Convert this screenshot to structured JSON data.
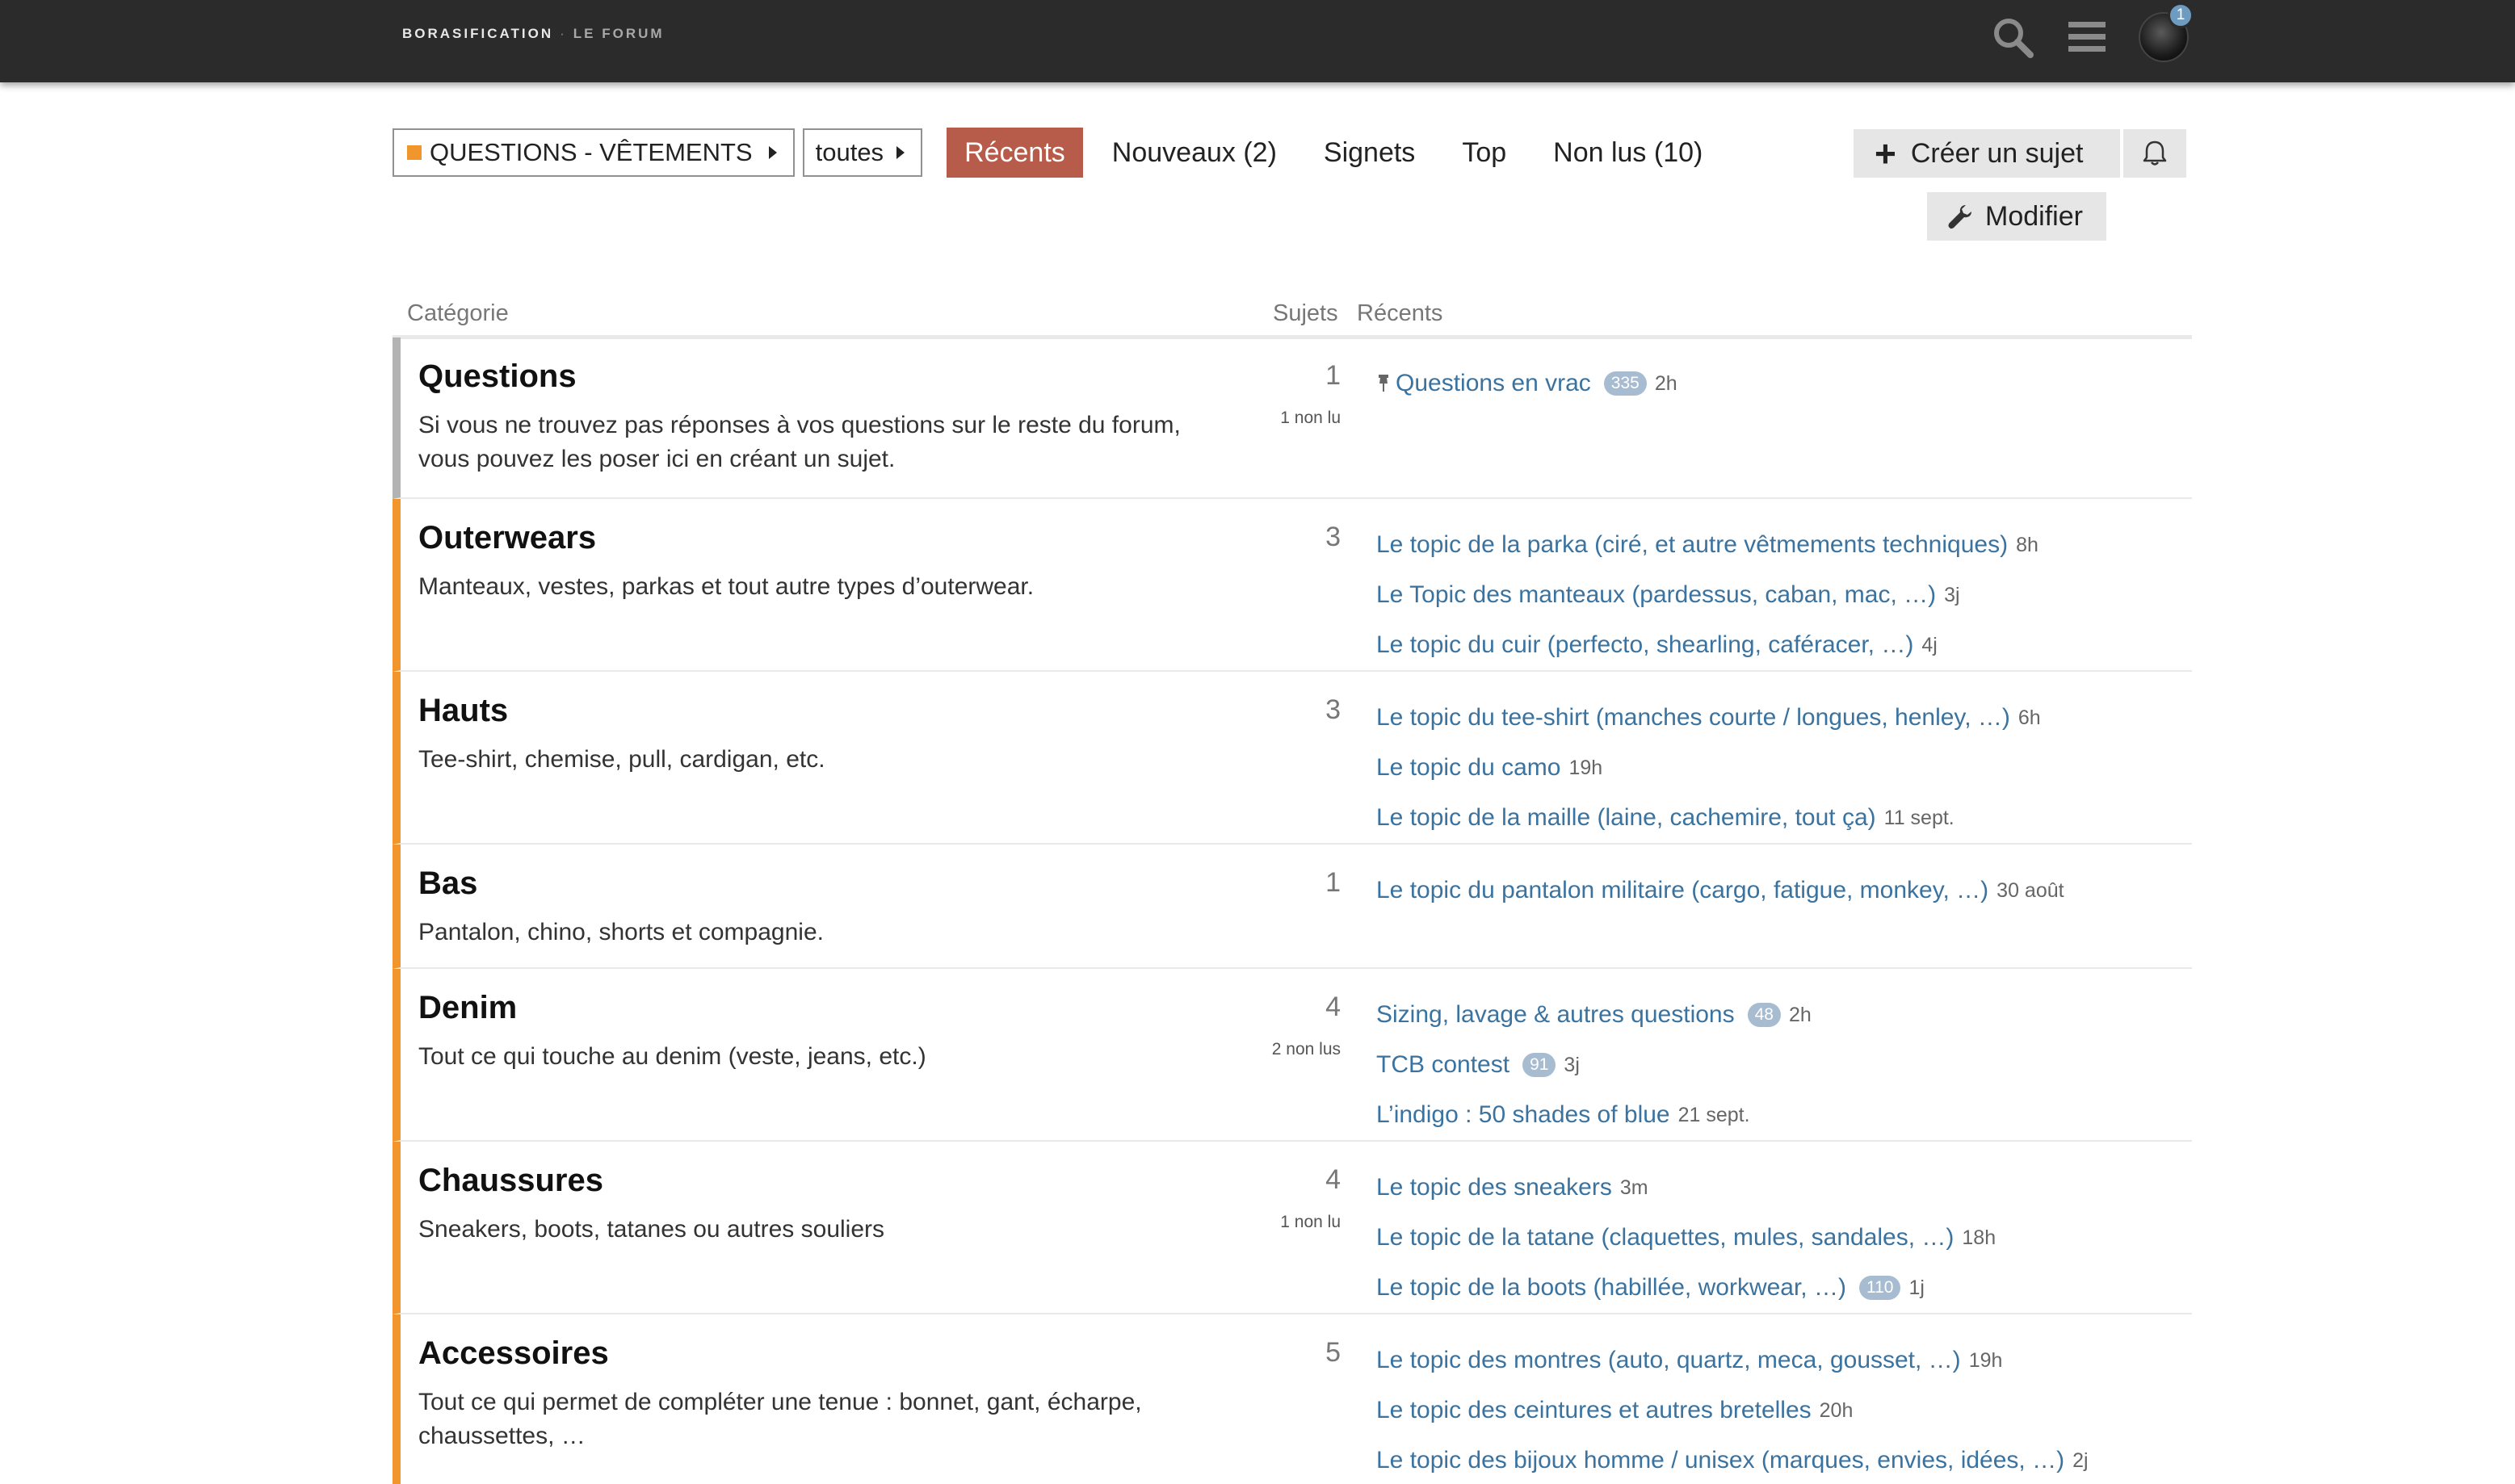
{
  "header": {
    "logo": "BORASIFICATION",
    "logo_sep": "·",
    "logo_sub": "LE FORUM",
    "icons": [
      "search-icon",
      "menu-icon",
      "avatar"
    ],
    "notification_count": "1"
  },
  "nav": {
    "category_dropdown": "QUESTIONS - VÊTEMENTS",
    "sub_dropdown": "toutes",
    "tabs": [
      {
        "label": "Récents",
        "active": true
      },
      {
        "label": "Nouveaux (2)",
        "active": false
      },
      {
        "label": "Signets",
        "active": false
      },
      {
        "label": "Top",
        "active": false
      },
      {
        "label": "Non lus (10)",
        "active": false
      }
    ],
    "create_button": "Créer un sujet",
    "edit_button": "Modifier"
  },
  "table": {
    "col_category": "Catégorie",
    "col_topics": "Sujets",
    "col_recent": "Récents",
    "rows": [
      {
        "name": "Questions",
        "desc": "Si vous ne trouvez pas réponses à vos questions sur le reste du forum, vous pouvez les poser ici en créant un sujet.",
        "count": "1",
        "unread": "1 non lu",
        "topics": [
          {
            "title": "Questions en vrac",
            "badge": "335",
            "age": "2h",
            "pinned": true
          }
        ]
      },
      {
        "name": "Outerwears",
        "desc": "Manteaux, vestes, parkas et tout autre types d’outerwear.",
        "count": "3",
        "unread": "",
        "topics": [
          {
            "title": "Le topic de la parka (ciré, et autre vêtmements techniques)",
            "badge": "",
            "age": "8h"
          },
          {
            "title": "Le Topic des manteaux (pardessus, caban, mac, …)",
            "badge": "",
            "age": "3j"
          },
          {
            "title": "Le topic du cuir (perfecto, shearling, caféracer, …)",
            "badge": "",
            "age": "4j"
          }
        ]
      },
      {
        "name": "Hauts",
        "desc": "Tee-shirt, chemise, pull, cardigan, etc.",
        "count": "3",
        "unread": "",
        "topics": [
          {
            "title": "Le topic du tee-shirt (manches courte / longues, henley, …)",
            "badge": "",
            "age": "6h"
          },
          {
            "title": "Le topic du camo",
            "badge": "",
            "age": "19h"
          },
          {
            "title": "Le topic de la maille (laine, cachemire, tout ça)",
            "badge": "",
            "age": "11 sept."
          }
        ]
      },
      {
        "name": "Bas",
        "desc": "Pantalon, chino, shorts et compagnie.",
        "count": "1",
        "unread": "",
        "topics": [
          {
            "title": "Le topic du pantalon militaire (cargo, fatigue, monkey, …)",
            "badge": "",
            "age": "30 août"
          }
        ]
      },
      {
        "name": "Denim",
        "desc": "Tout ce qui touche au denim (veste, jeans, etc.)",
        "count": "4",
        "unread": "2 non lus",
        "topics": [
          {
            "title": "Sizing, lavage & autres questions",
            "badge": "48",
            "age": "2h"
          },
          {
            "title": "TCB contest",
            "badge": "91",
            "age": "3j"
          },
          {
            "title": "L’indigo : 50 shades of blue",
            "badge": "",
            "age": "21 sept."
          }
        ]
      },
      {
        "name": "Chaussures",
        "desc": "Sneakers, boots, tatanes ou autres souliers",
        "count": "4",
        "unread": "1 non lu",
        "topics": [
          {
            "title": "Le topic des sneakers",
            "badge": "",
            "age": "3m"
          },
          {
            "title": "Le topic de la tatane (claquettes, mules, sandales, …)",
            "badge": "",
            "age": "18h"
          },
          {
            "title": "Le topic de la boots (habillée, workwear, …)",
            "badge": "110",
            "age": "1j"
          }
        ]
      },
      {
        "name": "Accessoires",
        "desc": "Tout ce qui permet de compléter une tenue : bonnet, gant, écharpe, chaussettes, …",
        "count": "5",
        "unread": "",
        "topics": [
          {
            "title": "Le topic des montres (auto, quartz, meca, gousset, …)",
            "badge": "",
            "age": "19h"
          },
          {
            "title": "Le topic des ceintures et autres bretelles",
            "badge": "",
            "age": "20h"
          },
          {
            "title": "Le topic des bijoux homme / unisex (marques, envies, idées, …)",
            "badge": "",
            "age": "2j"
          }
        ]
      }
    ]
  },
  "colors": {
    "header_bg": "#2b2b2b",
    "active_tab": "#b75c4a",
    "category_accent": "#f0962d",
    "questions_accent": "#b3b3b3",
    "link": "#3a73a0",
    "badge": "#a7bcd0"
  }
}
